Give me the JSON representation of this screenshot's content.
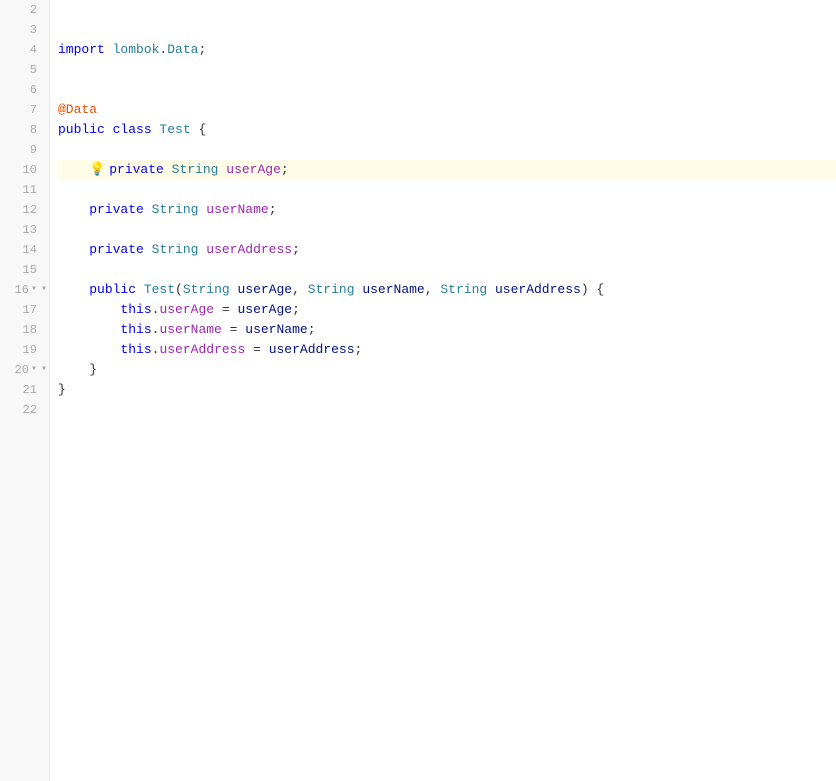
{
  "editor": {
    "lines": [
      {
        "num": 2,
        "tokens": [],
        "indent": 0
      },
      {
        "num": 3,
        "tokens": [],
        "indent": 0
      },
      {
        "num": 4,
        "tokens": [
          {
            "class": "kw",
            "text": "import "
          },
          {
            "class": "import-path",
            "text": "lombok"
          },
          {
            "class": "plain",
            "text": "."
          },
          {
            "class": "import-path",
            "text": "Data"
          },
          {
            "class": "plain",
            "text": ";"
          }
        ],
        "indent": 0
      },
      {
        "num": 5,
        "tokens": [],
        "indent": 0
      },
      {
        "num": 6,
        "tokens": [],
        "indent": 0
      },
      {
        "num": 7,
        "tokens": [
          {
            "class": "annot",
            "text": "@Data"
          }
        ],
        "indent": 0
      },
      {
        "num": 8,
        "tokens": [
          {
            "class": "kw",
            "text": "public "
          },
          {
            "class": "kw",
            "text": "class "
          },
          {
            "class": "type",
            "text": "Test"
          },
          {
            "class": "plain",
            "text": " {"
          }
        ],
        "indent": 0
      },
      {
        "num": 9,
        "tokens": [],
        "indent": 0
      },
      {
        "num": 10,
        "tokens": [
          {
            "class": "bulb",
            "text": "💡"
          },
          {
            "class": "kw",
            "text": "private "
          },
          {
            "class": "type",
            "text": "String"
          },
          {
            "class": "plain",
            "text": " "
          },
          {
            "class": "field",
            "text": "userAge"
          },
          {
            "class": "plain",
            "text": ";"
          }
        ],
        "indent": 1,
        "highlighted": true
      },
      {
        "num": 11,
        "tokens": [],
        "indent": 0
      },
      {
        "num": 12,
        "tokens": [
          {
            "class": "kw",
            "text": "private "
          },
          {
            "class": "type",
            "text": "String"
          },
          {
            "class": "plain",
            "text": " "
          },
          {
            "class": "field",
            "text": "userName"
          },
          {
            "class": "plain",
            "text": ";"
          }
        ],
        "indent": 1
      },
      {
        "num": 13,
        "tokens": [],
        "indent": 0
      },
      {
        "num": 14,
        "tokens": [
          {
            "class": "kw",
            "text": "private "
          },
          {
            "class": "type",
            "text": "String"
          },
          {
            "class": "plain",
            "text": " "
          },
          {
            "class": "field",
            "text": "userAddress"
          },
          {
            "class": "plain",
            "text": ";"
          }
        ],
        "indent": 1
      },
      {
        "num": 15,
        "tokens": [],
        "indent": 0
      },
      {
        "num": 16,
        "tokens": [
          {
            "class": "kw",
            "text": "public "
          },
          {
            "class": "type",
            "text": "Test"
          },
          {
            "class": "plain",
            "text": "("
          },
          {
            "class": "type",
            "text": "String"
          },
          {
            "class": "plain",
            "text": " "
          },
          {
            "class": "param",
            "text": "userAge"
          },
          {
            "class": "plain",
            "text": ", "
          },
          {
            "class": "type",
            "text": "String"
          },
          {
            "class": "plain",
            "text": " "
          },
          {
            "class": "param",
            "text": "userName"
          },
          {
            "class": "plain",
            "text": ", "
          },
          {
            "class": "type",
            "text": "String"
          },
          {
            "class": "plain",
            "text": " "
          },
          {
            "class": "param",
            "text": "userAddress"
          },
          {
            "class": "plain",
            "text": ") {"
          }
        ],
        "indent": 1,
        "fold": true
      },
      {
        "num": 17,
        "tokens": [
          {
            "class": "this-kw",
            "text": "this"
          },
          {
            "class": "plain",
            "text": "."
          },
          {
            "class": "field",
            "text": "userAge"
          },
          {
            "class": "plain",
            "text": " = "
          },
          {
            "class": "param",
            "text": "userAge"
          },
          {
            "class": "plain",
            "text": ";"
          }
        ],
        "indent": 2
      },
      {
        "num": 18,
        "tokens": [
          {
            "class": "this-kw",
            "text": "this"
          },
          {
            "class": "plain",
            "text": "."
          },
          {
            "class": "field",
            "text": "userName"
          },
          {
            "class": "plain",
            "text": " = "
          },
          {
            "class": "param",
            "text": "userName"
          },
          {
            "class": "plain",
            "text": ";"
          }
        ],
        "indent": 2
      },
      {
        "num": 19,
        "tokens": [
          {
            "class": "this-kw",
            "text": "this"
          },
          {
            "class": "plain",
            "text": "."
          },
          {
            "class": "field",
            "text": "userAddress"
          },
          {
            "class": "plain",
            "text": " = "
          },
          {
            "class": "param",
            "text": "userAddress"
          },
          {
            "class": "plain",
            "text": ";"
          }
        ],
        "indent": 2
      },
      {
        "num": 20,
        "tokens": [
          {
            "class": "plain",
            "text": "}"
          }
        ],
        "indent": 1,
        "fold": true
      },
      {
        "num": 21,
        "tokens": [
          {
            "class": "plain",
            "text": "}"
          }
        ],
        "indent": 0
      },
      {
        "num": 22,
        "tokens": [],
        "indent": 0
      }
    ]
  }
}
